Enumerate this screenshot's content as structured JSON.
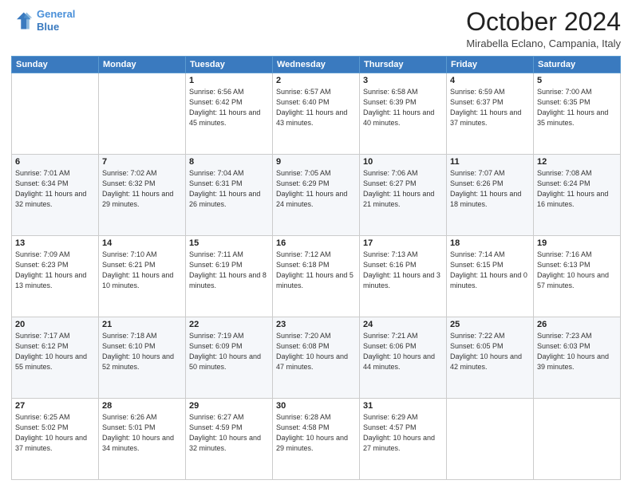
{
  "header": {
    "logo_line1": "General",
    "logo_line2": "Blue",
    "month_title": "October 2024",
    "location": "Mirabella Eclano, Campania, Italy"
  },
  "days_of_week": [
    "Sunday",
    "Monday",
    "Tuesday",
    "Wednesday",
    "Thursday",
    "Friday",
    "Saturday"
  ],
  "weeks": [
    [
      {
        "day": "",
        "info": ""
      },
      {
        "day": "",
        "info": ""
      },
      {
        "day": "1",
        "info": "Sunrise: 6:56 AM\nSunset: 6:42 PM\nDaylight: 11 hours and 45 minutes."
      },
      {
        "day": "2",
        "info": "Sunrise: 6:57 AM\nSunset: 6:40 PM\nDaylight: 11 hours and 43 minutes."
      },
      {
        "day": "3",
        "info": "Sunrise: 6:58 AM\nSunset: 6:39 PM\nDaylight: 11 hours and 40 minutes."
      },
      {
        "day": "4",
        "info": "Sunrise: 6:59 AM\nSunset: 6:37 PM\nDaylight: 11 hours and 37 minutes."
      },
      {
        "day": "5",
        "info": "Sunrise: 7:00 AM\nSunset: 6:35 PM\nDaylight: 11 hours and 35 minutes."
      }
    ],
    [
      {
        "day": "6",
        "info": "Sunrise: 7:01 AM\nSunset: 6:34 PM\nDaylight: 11 hours and 32 minutes."
      },
      {
        "day": "7",
        "info": "Sunrise: 7:02 AM\nSunset: 6:32 PM\nDaylight: 11 hours and 29 minutes."
      },
      {
        "day": "8",
        "info": "Sunrise: 7:04 AM\nSunset: 6:31 PM\nDaylight: 11 hours and 26 minutes."
      },
      {
        "day": "9",
        "info": "Sunrise: 7:05 AM\nSunset: 6:29 PM\nDaylight: 11 hours and 24 minutes."
      },
      {
        "day": "10",
        "info": "Sunrise: 7:06 AM\nSunset: 6:27 PM\nDaylight: 11 hours and 21 minutes."
      },
      {
        "day": "11",
        "info": "Sunrise: 7:07 AM\nSunset: 6:26 PM\nDaylight: 11 hours and 18 minutes."
      },
      {
        "day": "12",
        "info": "Sunrise: 7:08 AM\nSunset: 6:24 PM\nDaylight: 11 hours and 16 minutes."
      }
    ],
    [
      {
        "day": "13",
        "info": "Sunrise: 7:09 AM\nSunset: 6:23 PM\nDaylight: 11 hours and 13 minutes."
      },
      {
        "day": "14",
        "info": "Sunrise: 7:10 AM\nSunset: 6:21 PM\nDaylight: 11 hours and 10 minutes."
      },
      {
        "day": "15",
        "info": "Sunrise: 7:11 AM\nSunset: 6:19 PM\nDaylight: 11 hours and 8 minutes."
      },
      {
        "day": "16",
        "info": "Sunrise: 7:12 AM\nSunset: 6:18 PM\nDaylight: 11 hours and 5 minutes."
      },
      {
        "day": "17",
        "info": "Sunrise: 7:13 AM\nSunset: 6:16 PM\nDaylight: 11 hours and 3 minutes."
      },
      {
        "day": "18",
        "info": "Sunrise: 7:14 AM\nSunset: 6:15 PM\nDaylight: 11 hours and 0 minutes."
      },
      {
        "day": "19",
        "info": "Sunrise: 7:16 AM\nSunset: 6:13 PM\nDaylight: 10 hours and 57 minutes."
      }
    ],
    [
      {
        "day": "20",
        "info": "Sunrise: 7:17 AM\nSunset: 6:12 PM\nDaylight: 10 hours and 55 minutes."
      },
      {
        "day": "21",
        "info": "Sunrise: 7:18 AM\nSunset: 6:10 PM\nDaylight: 10 hours and 52 minutes."
      },
      {
        "day": "22",
        "info": "Sunrise: 7:19 AM\nSunset: 6:09 PM\nDaylight: 10 hours and 50 minutes."
      },
      {
        "day": "23",
        "info": "Sunrise: 7:20 AM\nSunset: 6:08 PM\nDaylight: 10 hours and 47 minutes."
      },
      {
        "day": "24",
        "info": "Sunrise: 7:21 AM\nSunset: 6:06 PM\nDaylight: 10 hours and 44 minutes."
      },
      {
        "day": "25",
        "info": "Sunrise: 7:22 AM\nSunset: 6:05 PM\nDaylight: 10 hours and 42 minutes."
      },
      {
        "day": "26",
        "info": "Sunrise: 7:23 AM\nSunset: 6:03 PM\nDaylight: 10 hours and 39 minutes."
      }
    ],
    [
      {
        "day": "27",
        "info": "Sunrise: 6:25 AM\nSunset: 5:02 PM\nDaylight: 10 hours and 37 minutes."
      },
      {
        "day": "28",
        "info": "Sunrise: 6:26 AM\nSunset: 5:01 PM\nDaylight: 10 hours and 34 minutes."
      },
      {
        "day": "29",
        "info": "Sunrise: 6:27 AM\nSunset: 4:59 PM\nDaylight: 10 hours and 32 minutes."
      },
      {
        "day": "30",
        "info": "Sunrise: 6:28 AM\nSunset: 4:58 PM\nDaylight: 10 hours and 29 minutes."
      },
      {
        "day": "31",
        "info": "Sunrise: 6:29 AM\nSunset: 4:57 PM\nDaylight: 10 hours and 27 minutes."
      },
      {
        "day": "",
        "info": ""
      },
      {
        "day": "",
        "info": ""
      }
    ]
  ]
}
